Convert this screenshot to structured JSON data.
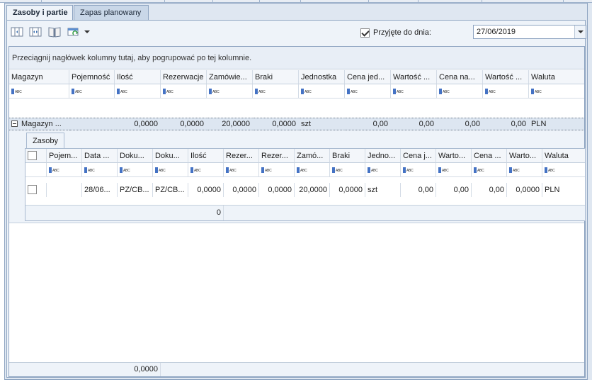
{
  "tabs": [
    {
      "label": "Zasoby i partie",
      "active": true
    },
    {
      "label": "Zapas planowany",
      "active": false
    }
  ],
  "toolbar": {
    "icons": [
      "columns-icon",
      "fit-columns-icon",
      "book-icon",
      "refresh-view-icon"
    ],
    "dropdown_icon": "chevron-down-icon",
    "accepted_label": "Przyjęte do dnia:",
    "accepted_checked": true,
    "date_value": "27/06/2019"
  },
  "group_panel_text": "Przeciągnij nagłówek kolumny tutaj, aby pogrupować po tej kolumnie.",
  "main_columns": [
    "Magazyn",
    "Pojemność",
    "Ilość",
    "Rezerwacje",
    "Zamówie...",
    "Braki",
    "Jednostka",
    "Cena jed...",
    "Wartość ...",
    "Cena na...",
    "Wartość ...",
    "Waluta"
  ],
  "filter_abc": "ABC",
  "group_row": {
    "magazyn": "Magazyn ...",
    "pojemnosc": "",
    "ilosc": "0,0000",
    "rezerwacje": "0,0000",
    "zamowienia": "20,0000",
    "braki": "0,0000",
    "jednostka": "szt",
    "cena_jed": "0,00",
    "wartosc1": "0,00",
    "cena_na": "0,00",
    "wartosc2": "0,00",
    "waluta": "PLN"
  },
  "detail": {
    "tab_label": "Zasoby",
    "columns": [
      "",
      "Pojem...",
      "Data ...",
      "Doku...",
      "Doku...",
      "Ilość",
      "Rezer...",
      "Rezer...",
      "Zamó...",
      "Braki",
      "Jedno...",
      "Cena j...",
      "Warto...",
      "Cena ...",
      "Warto...",
      "Waluta"
    ],
    "row": {
      "pojemnosc": "",
      "data": "28/06...",
      "dok1": "PZ/CB...",
      "dok2": "PZ/CB...",
      "ilosc": "0,0000",
      "rez1": "0,0000",
      "rez2": "0,0000",
      "zam": "20,0000",
      "braki": "0,0000",
      "jedn": "szt",
      "cena1": "0,00",
      "wart1": "0,00",
      "cena2": "0,00",
      "wart2": "0,0000",
      "waluta": "PLN"
    },
    "footer_sum": "0"
  },
  "footer_sum": "0,0000"
}
